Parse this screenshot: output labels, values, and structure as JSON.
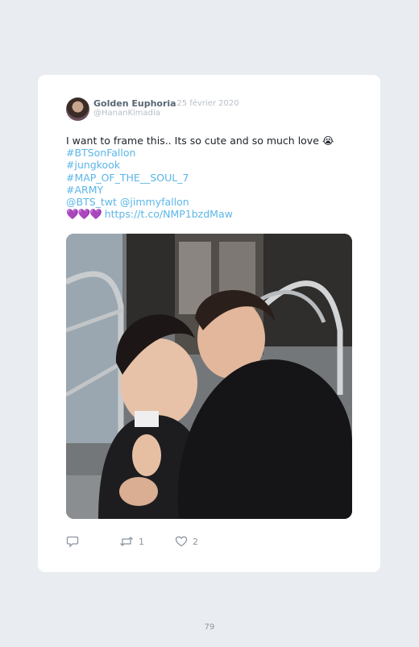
{
  "tweet": {
    "display_name": "Golden Euphoria",
    "date": "· 25 février 2020",
    "handle": "@HananKimadia",
    "text_line1": "I want to frame this.. Its so cute and so much love",
    "text_emoji": "😭",
    "hashtags": [
      "#BTSonFallon",
      "#jungkook",
      "#MAP_OF_THE__SOUL_7",
      "#ARMY"
    ],
    "mention_1": "@BTS_twt",
    "mention_2": "@jimmyfallon",
    "hearts": "💜💜💜",
    "link": "https://t.co/NMP1bzdMaw",
    "retweet_count": "1",
    "like_count": "2"
  },
  "icons": {
    "reply": "reply-icon",
    "retweet": "retweet-icon",
    "like": "heart-icon"
  },
  "colors": {
    "background": "#e9ecf0",
    "card": "#ffffff",
    "link": "#5bb6e8",
    "name": "#596673",
    "muted": "#b7bec6"
  },
  "footer": {
    "page_number": "79"
  }
}
